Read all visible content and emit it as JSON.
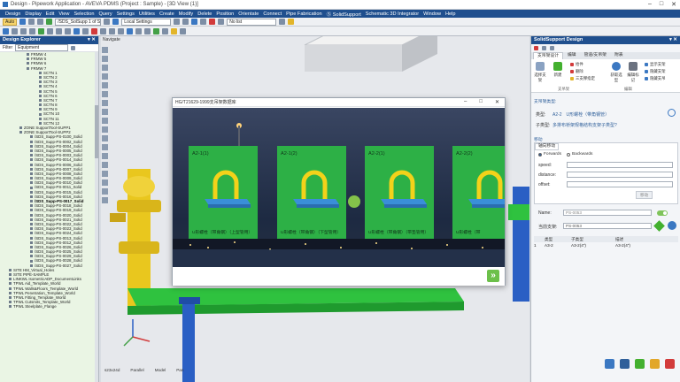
{
  "window": {
    "title": "Design - Pipework Application - AVEVA PDMS (Project : Sample) - [3D View (1)]",
    "controls": [
      "–",
      "□",
      "✕"
    ]
  },
  "menu": [
    "Design",
    "Display",
    "Edit",
    "View",
    "Selection",
    "Query",
    "Settings",
    "Utilities",
    "Create",
    "Modify",
    "Delete",
    "Position",
    "Orientate",
    "Connect",
    "Pipe Fabrication",
    "Ⓢ SolidSupport",
    "Schematic 3D Integrator",
    "Window",
    "Help"
  ],
  "toolbar": {
    "auto_label": "Auto",
    "element_select": "/SDS_SolSupp 1 of SDS_Sup",
    "settings_select": "Local Settings",
    "list_select": "No list"
  },
  "explorer": {
    "title": "Design Explorer",
    "pin": "▾ ✕",
    "filter_label": "Filter",
    "filter_value": "Equipment",
    "rows": [
      {
        "text": "FRMW 4",
        "indent": 30
      },
      {
        "text": "FRMW 5",
        "indent": 30
      },
      {
        "text": "FRMW 6",
        "indent": 30
      },
      {
        "text": "FRMW 7",
        "indent": 30
      },
      {
        "text": "SCTN 1",
        "indent": 44
      },
      {
        "text": "SCTN 2",
        "indent": 44
      },
      {
        "text": "SCTN 3",
        "indent": 44
      },
      {
        "text": "SCTN 4",
        "indent": 44
      },
      {
        "text": "SCTN 5",
        "indent": 44
      },
      {
        "text": "SCTN 6",
        "indent": 44
      },
      {
        "text": "SCTN 7",
        "indent": 44
      },
      {
        "text": "SCTN 8",
        "indent": 44
      },
      {
        "text": "SCTN 9",
        "indent": 44
      },
      {
        "text": "SCTN 10",
        "indent": 44
      },
      {
        "text": "SCTN 11",
        "indent": 44
      },
      {
        "text": "SCTN 12",
        "indent": 44
      },
      {
        "text": "ZONE SupportTool-SUPP1",
        "indent": 22
      },
      {
        "text": "ZONE SupportTool-SUPP2",
        "indent": 22
      },
      {
        "text": "/SDS_Supp-PS-0100_Solid",
        "indent": 34
      },
      {
        "text": "/SDS_Supp-PS-0002_Solid",
        "indent": 34
      },
      {
        "text": "/SDS_Supp-PS-0004_Solid",
        "indent": 34
      },
      {
        "text": "/SDS_Supp-PS-0005_Solid",
        "indent": 34
      },
      {
        "text": "/SDS_Supp-PS-0003_Solid",
        "indent": 34
      },
      {
        "text": "/SDS_Supp-PS-0014_Solid",
        "indent": 34
      },
      {
        "text": "/SDS_Supp-PS-0006_Solid",
        "indent": 34
      },
      {
        "text": "/SDS_Supp-PS-0007_Solid",
        "indent": 34
      },
      {
        "text": "/SDS_Supp-PS-0008_Solid",
        "indent": 34
      },
      {
        "text": "/SDS_Supp-PS-0009_Solid",
        "indent": 34
      },
      {
        "text": "/SDS_Supp-PS-0010_Solid",
        "indent": 34
      },
      {
        "text": "/SDS_Supp-PS-0011_Solid",
        "indent": 34
      },
      {
        "text": "/SDS_Supp-PS-0015_Solid",
        "indent": 34
      },
      {
        "text": "/SDS_Supp-PS-0016_Solid",
        "indent": 34
      },
      {
        "text": "/SDS_Supp-PS-0017_Solid",
        "indent": 34,
        "selected": true
      },
      {
        "text": "/SDS_Supp-PS-0018_Solid",
        "indent": 34
      },
      {
        "text": "/SDS_Supp-PS-0019_Solid",
        "indent": 34
      },
      {
        "text": "/SDS_Supp-PS-0020_Solid",
        "indent": 34
      },
      {
        "text": "/SDS_Supp-PS-0021_Solid",
        "indent": 34
      },
      {
        "text": "/SDS_Supp-PS-0022_Solid",
        "indent": 34
      },
      {
        "text": "/SDS_Supp-PS-0023_Solid",
        "indent": 34
      },
      {
        "text": "/SDS_Supp-PS-0024_Solid",
        "indent": 34
      },
      {
        "text": "/SDS_Supp-PS-0013_Solid",
        "indent": 34
      },
      {
        "text": "/SDS_Supp-PS-0012_Solid",
        "indent": 34
      },
      {
        "text": "/SDS_Supp-PS-0026_Solid",
        "indent": 34
      },
      {
        "text": "/SDS_Supp-PS-0025_Solid",
        "indent": 34
      },
      {
        "text": "/SDS_Supp-PS-0029_Solid",
        "indent": 34
      },
      {
        "text": "/SDS_Supp-PS-0028_Solid",
        "indent": 34
      },
      {
        "text": "/SDS_Supp-PS-0027_Solid",
        "indent": 34
      },
      {
        "text": "SITE HM_Virtual_Holes",
        "indent": 10
      },
      {
        "text": "SITE PIPE-SAMPLE",
        "indent": 10
      },
      {
        "text": "LINKWL IsometricADP_DocumentLinks",
        "indent": 10
      },
      {
        "text": "TPWL Aid_Template_World",
        "indent": 10
      },
      {
        "text": "TPWL Walls&Floors_Template_World",
        "indent": 10
      },
      {
        "text": "TPWL Penetration_Template_World",
        "indent": 10
      },
      {
        "text": "TPWL Fitting_Template_World",
        "indent": 10
      },
      {
        "text": "TPWL Cutsmits_Template_World",
        "indent": 10
      },
      {
        "text": "TPWL Steelplate_Flange",
        "indent": 10
      }
    ]
  },
  "view3d": {
    "title": "Navigate",
    "status": [
      "s23x24d",
      "Parallel",
      "Model",
      "Pan"
    ]
  },
  "modal": {
    "title": "HG/T21629-1999支吊架数据库",
    "controls": [
      "–",
      "□",
      "✕"
    ],
    "next_label": "»",
    "cards": [
      {
        "code": "A2-1(1)",
        "desc": "U形螺栓（带角钢）（上型管用）"
      },
      {
        "code": "A2-1(2)",
        "desc": "U形螺栓（带角钢）（下型管用）"
      },
      {
        "code": "A2-2(1)",
        "desc": "U形螺栓（带角钢）（带垫管用）"
      },
      {
        "code": "A2-2(2)",
        "desc": "U形螺栓（带"
      }
    ]
  },
  "rpanel": {
    "title": "SolidSupport Design",
    "tabs": [
      "支吊架设计",
      "编辑",
      "管道/支吊架",
      "附表"
    ],
    "ribbon": {
      "big": [
        "选择支架",
        "新建",
        "删除"
      ],
      "small_left": [
        "拾件",
        "删除",
        "三支撑指定"
      ],
      "big2": "获取选型",
      "big3": "编辑标记",
      "small_right": [
        "显示支架",
        "隐藏支架",
        "隐藏支吊"
      ],
      "group1": "支吊架",
      "group2": "编辑"
    },
    "section1": "支吊架类型:",
    "type_label": "类型:",
    "type_value": "A2-2　U形螺栓（带角钢管）",
    "subtype_label": "子类型:",
    "subtype_value": "多排布桥架规格结构支架子类型?",
    "section2": "移动",
    "axis_tab": "轴向移动",
    "radio_forwards": "Forwards",
    "radio_backwards": "Backwards",
    "speed_label": "speed:",
    "distance_label": "distance:",
    "offset_label": "offset:",
    "move_btn": "移动",
    "name_label": "Name:",
    "name_value": "PS-0053",
    "current_label": "当前支架:",
    "current_value": "PS-0053",
    "table_headers": [
      "",
      "类型",
      "子类型",
      "描述"
    ],
    "table_rows": [
      [
        "1",
        "A3-2",
        "A3-2(4\")",
        "A3-2(4\")"
      ]
    ]
  }
}
